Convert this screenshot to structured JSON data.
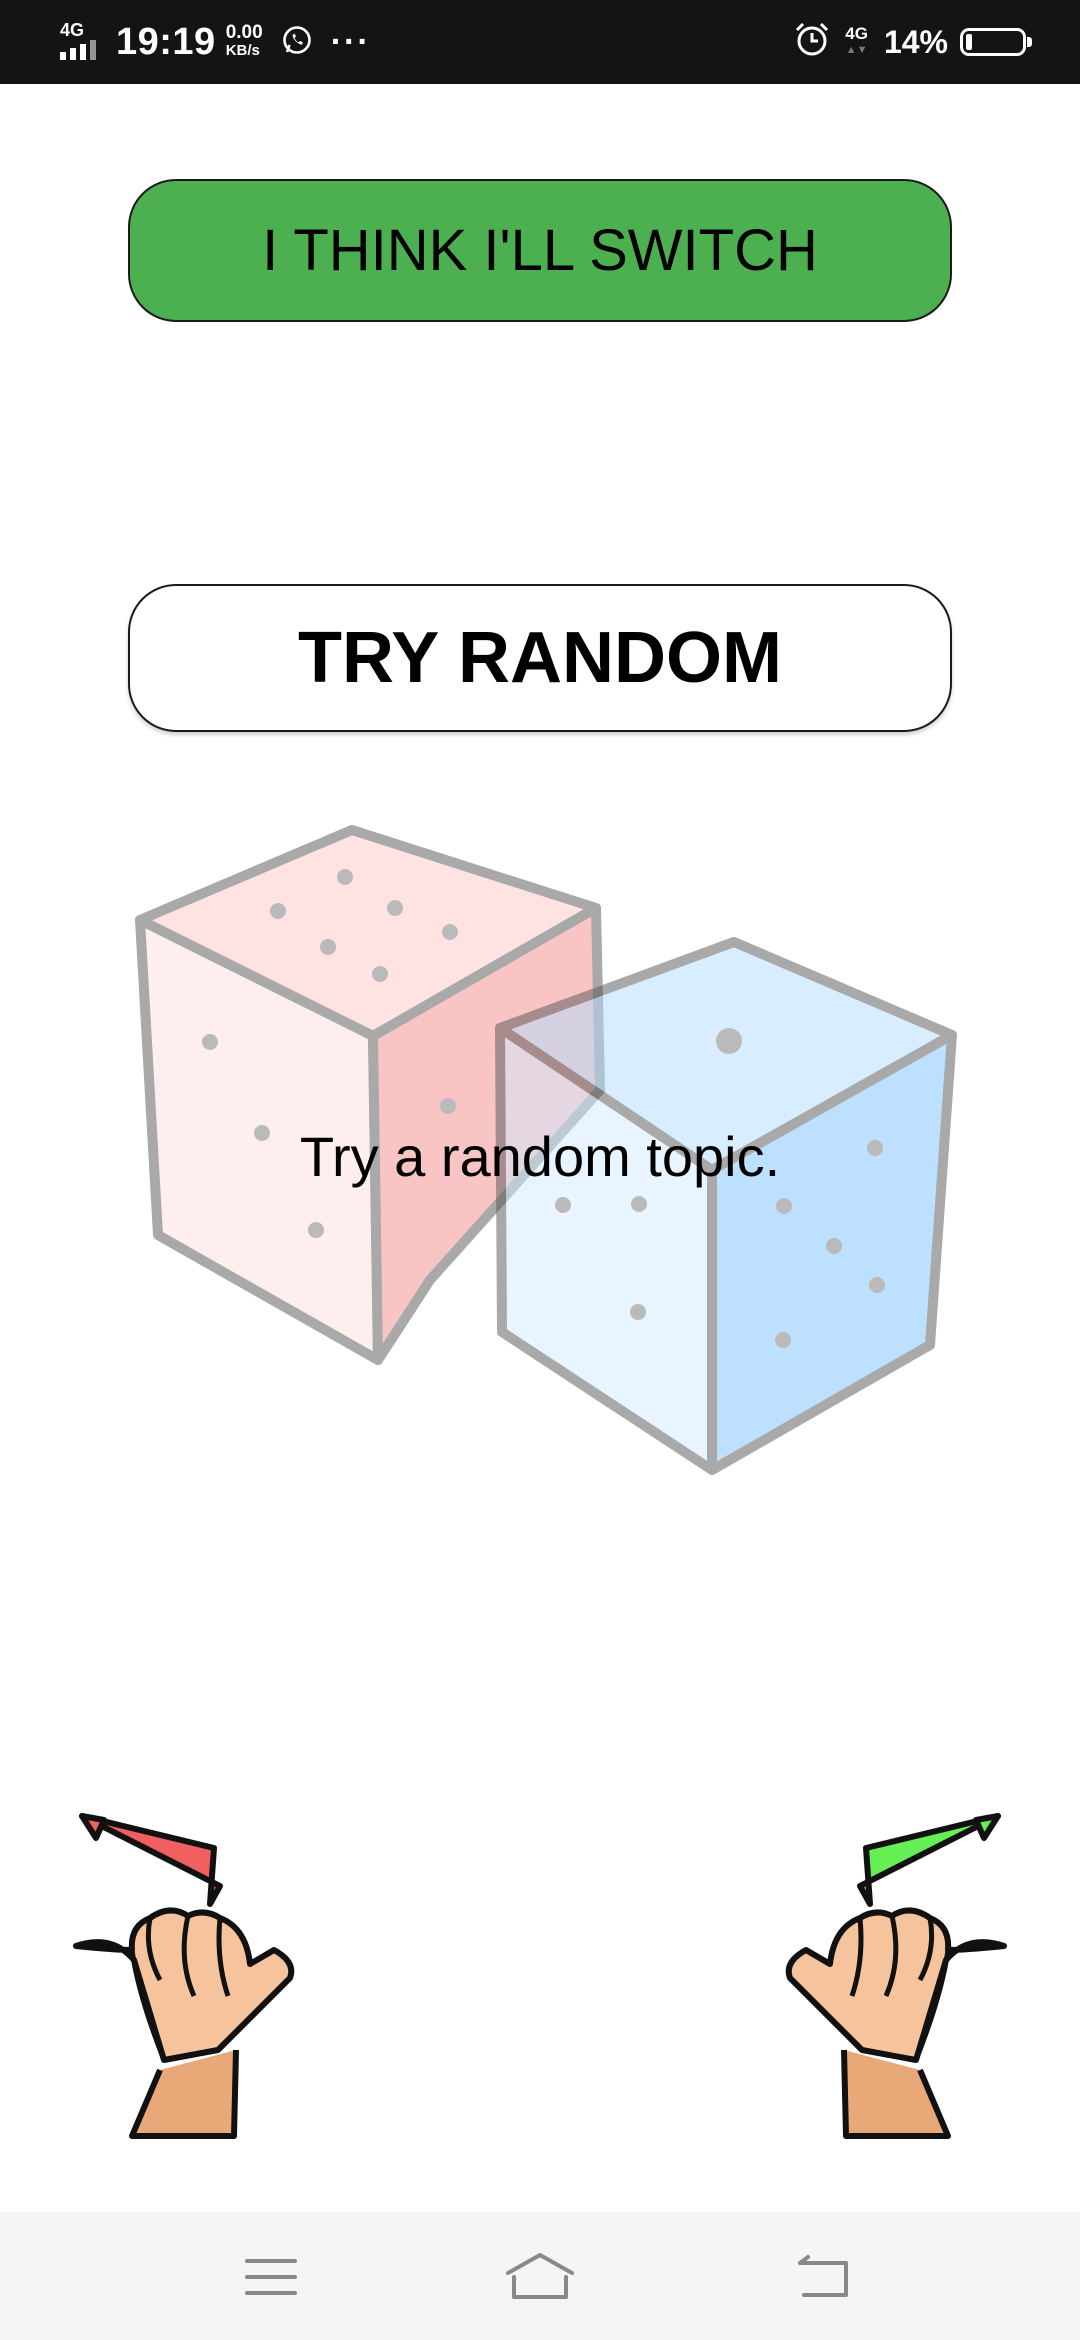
{
  "status_bar": {
    "network_label": "4G",
    "time": "19:19",
    "speed_value": "0.00",
    "speed_unit": "KB/s",
    "more": "···",
    "network_label_small": "4G",
    "battery_percent": "14%",
    "icons": [
      "signal-icon",
      "whatsapp-icon",
      "alarm-icon",
      "battery-icon"
    ]
  },
  "buttons": {
    "switch_label": "I THINK I'LL SWITCH",
    "switch_color": "#4caf50",
    "random_label": "TRY RANDOM"
  },
  "illustration": {
    "caption": "Try a random topic.",
    "icons": [
      "red-die-icon",
      "blue-die-icon"
    ]
  },
  "hands": {
    "left_arrow_color": "#f06060",
    "right_arrow_color": "#66ee55",
    "icons": [
      "thumb-left-hand-icon",
      "thumb-right-hand-icon"
    ]
  },
  "nav_bar": {
    "icons": [
      "menu-icon",
      "home-icon",
      "back-icon"
    ]
  }
}
